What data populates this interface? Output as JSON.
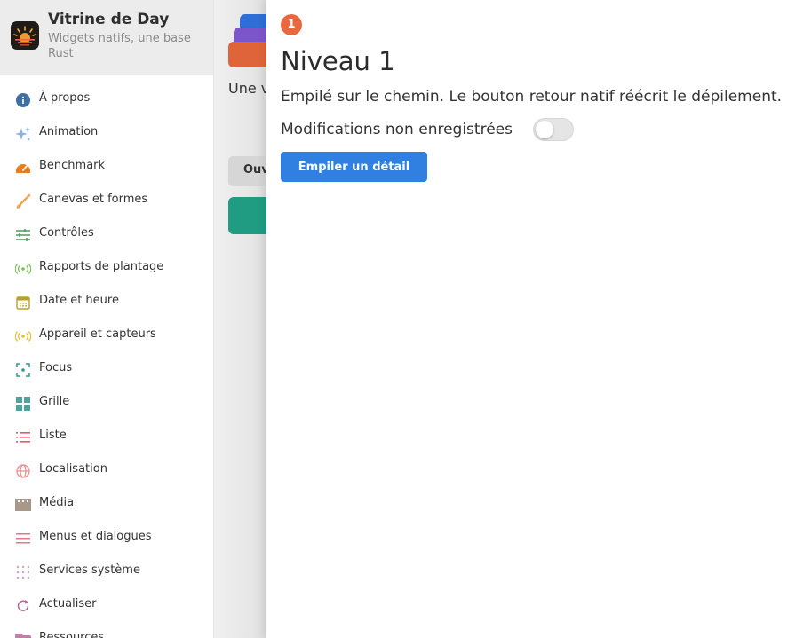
{
  "app": {
    "title": "Vitrine de Day",
    "subtitle": "Widgets natifs, une base Rust",
    "icon": "sunrise-app-icon"
  },
  "sidebar": {
    "items": [
      {
        "label": "À propos",
        "icon": "info-icon",
        "color": "#3f6fa3"
      },
      {
        "label": "Animation",
        "icon": "sparkle-icon",
        "color": "#8ab4e8"
      },
      {
        "label": "Benchmark",
        "icon": "speedometer-icon",
        "color": "#e87d1e"
      },
      {
        "label": "Canevas et formes",
        "icon": "brush-icon",
        "color": "#f0a458"
      },
      {
        "label": "Contrôles",
        "icon": "sliders-icon",
        "color": "#4a9a5a"
      },
      {
        "label": "Rapports de plantage",
        "icon": "signal-icon",
        "color": "#7ac05a"
      },
      {
        "label": "Date et heure",
        "icon": "calendar-icon",
        "color": "#b8a032"
      },
      {
        "label": "Appareil et capteurs",
        "icon": "sensor-icon",
        "color": "#e8c030"
      },
      {
        "label": "Focus",
        "icon": "focus-icon",
        "color": "#2f9a8a"
      },
      {
        "label": "Grille",
        "icon": "grid-icon",
        "color": "#4fa39a"
      },
      {
        "label": "Liste",
        "icon": "list-icon",
        "color": "#e05a6a"
      },
      {
        "label": "Localisation",
        "icon": "globe-icon",
        "color": "#e88a8a"
      },
      {
        "label": "Média",
        "icon": "clapper-icon",
        "color": "#a8988a"
      },
      {
        "label": "Menus et dialogues",
        "icon": "menu-icon",
        "color": "#e07a8a"
      },
      {
        "label": "Services système",
        "icon": "dots-grid-icon",
        "color": "#d8a0c0"
      },
      {
        "label": "Actualiser",
        "icon": "refresh-icon",
        "color": "#b06aa0"
      },
      {
        "label": "Ressources",
        "icon": "folder-icon",
        "color": "#c080a8"
      }
    ]
  },
  "background_page": {
    "text": "Une v",
    "button_label": "Ouv"
  },
  "panel": {
    "badge": "1",
    "title": "Niveau 1",
    "description": "Empilé sur le chemin. Le bouton retour natif réécrit le dépilement.",
    "toggle_label": "Modifications non enregistrées",
    "toggle_on": false,
    "push_button": "Empiler un détail"
  },
  "colors": {
    "accent": "#2f80e0",
    "badge": "#e8683f"
  }
}
